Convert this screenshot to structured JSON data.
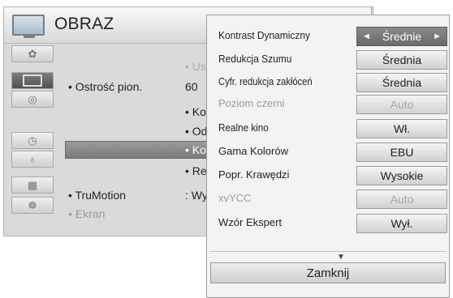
{
  "background_menu": {
    "title": "OBRAZ",
    "header_icon": "tv-icon",
    "categories": [
      {
        "icon": "picture-category-icon",
        "active": false
      },
      {
        "icon": "tv-category-icon",
        "active": true
      },
      {
        "icon": "audio-category-icon",
        "active": false
      },
      {
        "icon": "clock-category-icon",
        "active": false
      },
      {
        "icon": "lock-category-icon",
        "active": false
      },
      {
        "icon": "options-category-icon",
        "active": false
      },
      {
        "icon": "network-category-icon",
        "active": false
      }
    ],
    "options": [
      {
        "label": "• Ostrość pion.",
        "value": "60"
      },
      {
        "label": "• TruMotion",
        "value": ": Wy"
      },
      {
        "label": "• Ekran",
        "value": ""
      }
    ],
    "partial_values": [
      "• Us",
      "• Ko",
      "• Od",
      "• Kol",
      "• Re"
    ]
  },
  "popup": {
    "rows": [
      {
        "label": "Kontrast Dynamiczny",
        "value": "Średnie",
        "selected": true,
        "dimmed": false
      },
      {
        "label": "Redukcja Szumu",
        "value": "Średnia",
        "selected": false,
        "dimmed": false
      },
      {
        "label": "Cyfr. redukcja zakłóceń",
        "value": "Średnia",
        "selected": false,
        "dimmed": false
      },
      {
        "label": "Poziom czerni",
        "value": "Auto",
        "selected": false,
        "dimmed": true
      },
      {
        "label": "Realne kino",
        "value": "Wł.",
        "selected": false,
        "dimmed": false
      },
      {
        "label": "Gama Kolorów",
        "value": "EBU",
        "selected": false,
        "dimmed": false
      },
      {
        "label": "Popr. Krawędzi",
        "value": "Wysokie",
        "selected": false,
        "dimmed": false
      },
      {
        "label": "xvYCC",
        "value": "Auto",
        "selected": false,
        "dimmed": true
      },
      {
        "label": "Wzór Ekspert",
        "value": "Wył.",
        "selected": false,
        "dimmed": false
      }
    ],
    "left_arrow": "◄",
    "right_arrow": "►",
    "more_indicator": "▼",
    "close_label": "Zamknij"
  },
  "colors": {
    "selected_bg": "#7a7a7a",
    "dim_text": "#9c9c9c"
  }
}
